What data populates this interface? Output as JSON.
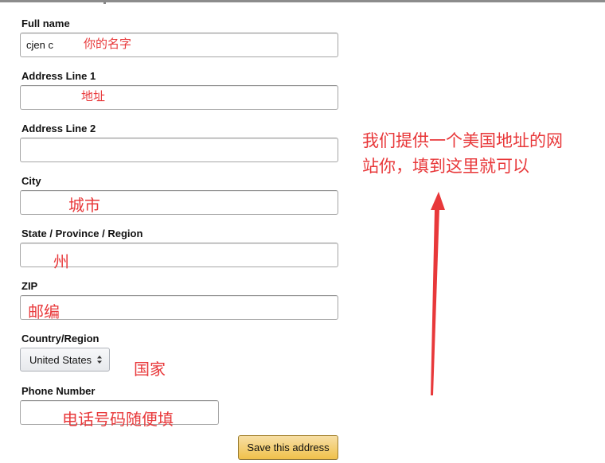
{
  "form": {
    "full_name": {
      "label": "Full name",
      "value": "cjen c",
      "annotation": "你的名字"
    },
    "address_line_1": {
      "label": "Address Line 1",
      "value": "",
      "annotation": "地址"
    },
    "address_line_2": {
      "label": "Address Line 2",
      "value": ""
    },
    "city": {
      "label": "City",
      "value": "",
      "annotation": "城市"
    },
    "state": {
      "label": "State / Province / Region",
      "value": "",
      "annotation": "州"
    },
    "zip": {
      "label": "ZIP",
      "value": "",
      "annotation": "邮编"
    },
    "country": {
      "label": "Country/Region",
      "selected": "United States",
      "annotation": "国家"
    },
    "phone": {
      "label": "Phone Number",
      "value": "",
      "annotation": "电话号码随便填"
    },
    "save_label": "Save this address"
  },
  "side_note": {
    "line1": "我们提供一个美国地址的网",
    "line2": "站你，填到这里就可以"
  },
  "colors": {
    "annotation_red": "#e8383a",
    "button_gold": "#f0c14b"
  },
  "icons": {
    "select_caret": "updown-caret-icon",
    "arrow": "up-arrow-icon"
  }
}
